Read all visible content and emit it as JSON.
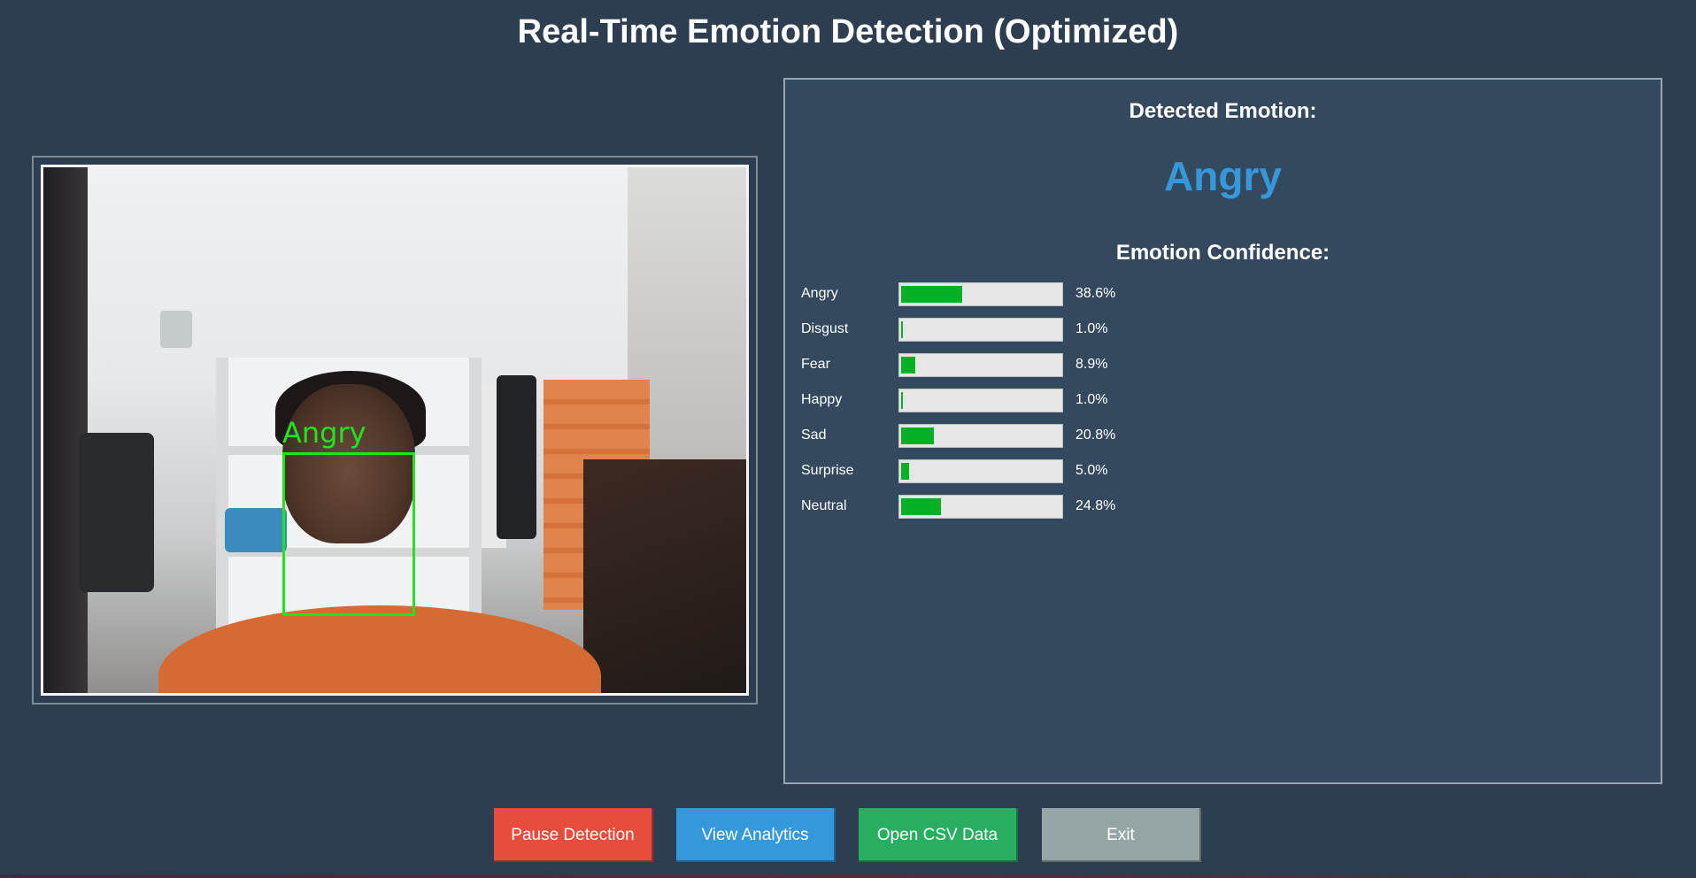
{
  "window": {
    "title": "Real-Time Emotion Detection (Optimized)"
  },
  "video": {
    "face_label": "Angry",
    "box_color": "#1ee61e"
  },
  "panel": {
    "detected_label": "Detected Emotion:",
    "detected_emotion": "Angry",
    "detected_color": "#3498db",
    "confidence_title": "Emotion Confidence:",
    "bar_color": "#06b025",
    "emotions": [
      {
        "name": "Angry",
        "value": 38.6,
        "pct_text": "38.6%"
      },
      {
        "name": "Disgust",
        "value": 1.0,
        "pct_text": "1.0%"
      },
      {
        "name": "Fear",
        "value": 8.9,
        "pct_text": "8.9%"
      },
      {
        "name": "Happy",
        "value": 1.0,
        "pct_text": "1.0%"
      },
      {
        "name": "Sad",
        "value": 20.8,
        "pct_text": "20.8%"
      },
      {
        "name": "Surprise",
        "value": 5.0,
        "pct_text": "5.0%"
      },
      {
        "name": "Neutral",
        "value": 24.8,
        "pct_text": "24.8%"
      }
    ]
  },
  "buttons": {
    "pause": {
      "label": "Pause Detection",
      "color": "#e74c3c"
    },
    "analytics": {
      "label": "View Analytics",
      "color": "#3498db"
    },
    "csv": {
      "label": "Open CSV Data",
      "color": "#27ae60"
    },
    "exit": {
      "label": "Exit",
      "color": "#95a5a6"
    }
  }
}
